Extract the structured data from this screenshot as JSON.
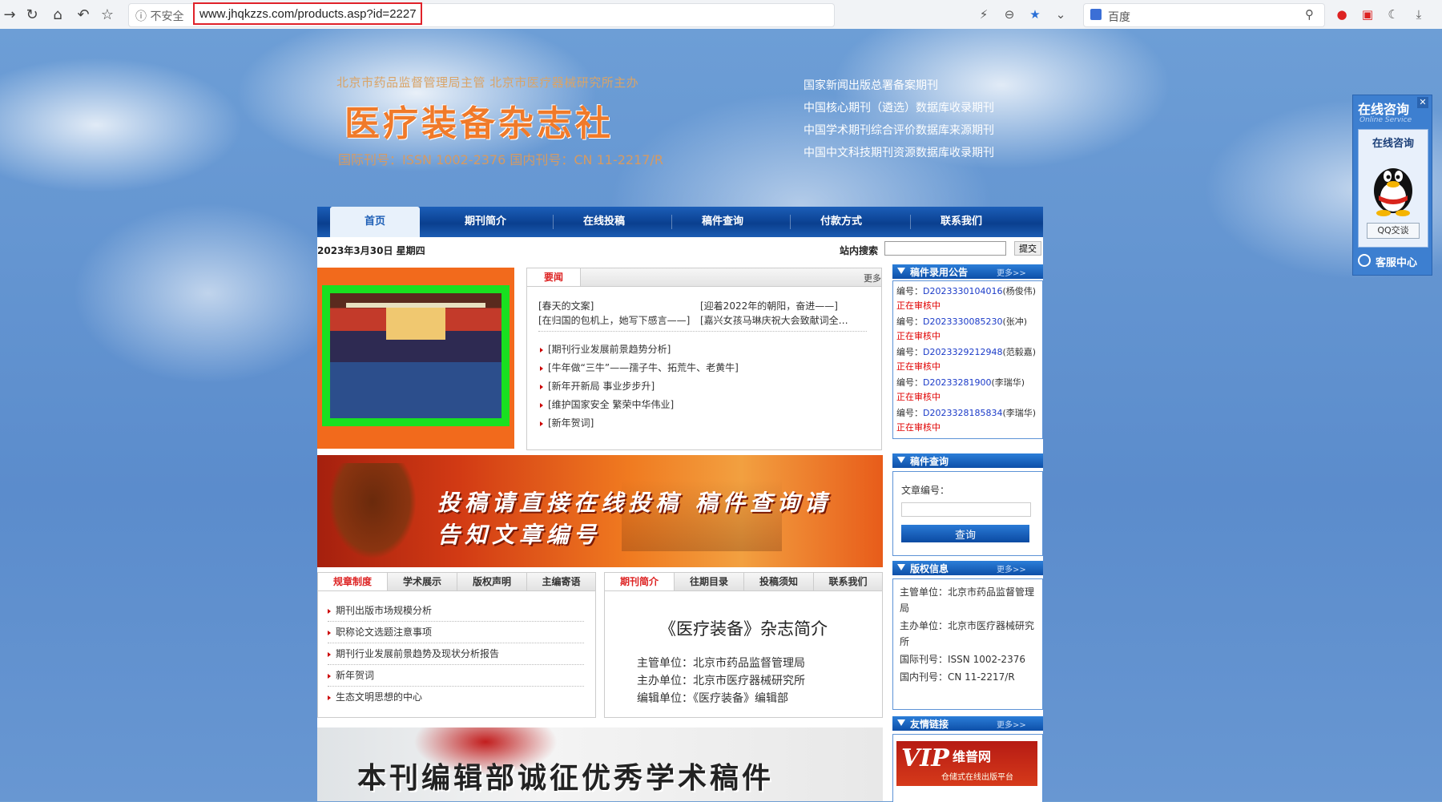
{
  "browser": {
    "security_label": "不安全",
    "url": "www.jhqkzzs.com/products.asp?id=2227",
    "search_engine": "百度"
  },
  "header": {
    "sponsor": "北京市药品监督管理局主管  北京市医疗器械研究所主办",
    "title": "医疗装备杂志社",
    "issn": "国际刊号：ISSN 1002-2376  国内刊号：CN 11-2217/R",
    "indexing": [
      "国家新闻出版总署备案期刊",
      "中国核心期刊（遴选）数据库收录期刊",
      "中国学术期刊综合评价数据库来源期刊",
      "中国中文科技期刊资源数据库收录期刊"
    ]
  },
  "nav": {
    "items": [
      "首页",
      "期刊简介",
      "在线投稿",
      "稿件查询",
      "付款方式",
      "联系我们"
    ]
  },
  "datebar": {
    "date": "2023年3月30日 星期四",
    "search_label": "站内搜索",
    "submit": "提交"
  },
  "news": {
    "tab": "要闻",
    "more": "更多",
    "top_left": [
      "[春天的文案]",
      "[在归国的包机上，她写下感言——]"
    ],
    "top_right": [
      "[迎着2022年的朝阳，奋进——]",
      "[嘉兴女孩马琳庆祝大会致献词全…"
    ],
    "items": [
      "[期刊行业发展前景趋势分析]",
      "[牛年做“三牛”——孺子牛、拓荒牛、老黄牛]",
      "[新年开新局 事业步步升]",
      "[维护国家安全 繁荣中华伟业]",
      "[新年贺词]"
    ]
  },
  "banner1": {
    "line1": "投稿请直接在线投稿  稿件查询请",
    "line2": "告知文章编号"
  },
  "tabbox1": {
    "tabs": [
      "规章制度",
      "学术展示",
      "版权声明",
      "主编寄语"
    ],
    "items": [
      "期刊出版市场规模分析",
      "职称论文选题注意事项",
      "期刊行业发展前景趋势及现状分析报告",
      "新年贺词",
      "生态文明思想的中心"
    ]
  },
  "tabbox2": {
    "tabs": [
      "期刊简介",
      "往期目录",
      "投稿须知",
      "联系我们"
    ],
    "intro_title": "《医疗装备》杂志简介",
    "lines": [
      "主管单位：北京市药品监督管理局",
      "主办单位：北京市医疗器械研究所",
      "编辑单位：《医疗装备》编辑部"
    ]
  },
  "banner2": {
    "text": "本刊编辑部诚征优秀学术稿件"
  },
  "sidebar": {
    "records": {
      "title": "稿件录用公告",
      "more": "更多>>",
      "prefix": "编号：",
      "status": "正在审核中",
      "rows": [
        {
          "id": "D2023330104016",
          "name": "(杨俊伟)"
        },
        {
          "id": "D2023330085230",
          "name": "(张冲)"
        },
        {
          "id": "D2023329212948",
          "name": "(范毅嘉)"
        },
        {
          "id": "D20233281900",
          "name": "(李瑞华)"
        },
        {
          "id": "D2023328185834",
          "name": "(李瑞华)"
        }
      ]
    },
    "query": {
      "title": "稿件查询",
      "label": "文章编号：",
      "button": "查询"
    },
    "copyright": {
      "title": "版权信息",
      "more": "更多>>",
      "lines": [
        "主管单位：北京市药品监督管理局",
        "主办单位：北京市医疗器械研究所",
        "国际刊号：ISSN 1002-2376",
        "国内刊号：CN 11-2217/R"
      ]
    },
    "links": {
      "title": "友情链接",
      "more": "更多>>",
      "logo_name": "维普网",
      "logo_sub": "仓储式在线出版平台"
    }
  },
  "qq_widget": {
    "title": "在线咨询",
    "subtitle": "Online Service",
    "panel_label": "在线咨询",
    "button": "QQ交谈",
    "footer": "客服中心"
  }
}
